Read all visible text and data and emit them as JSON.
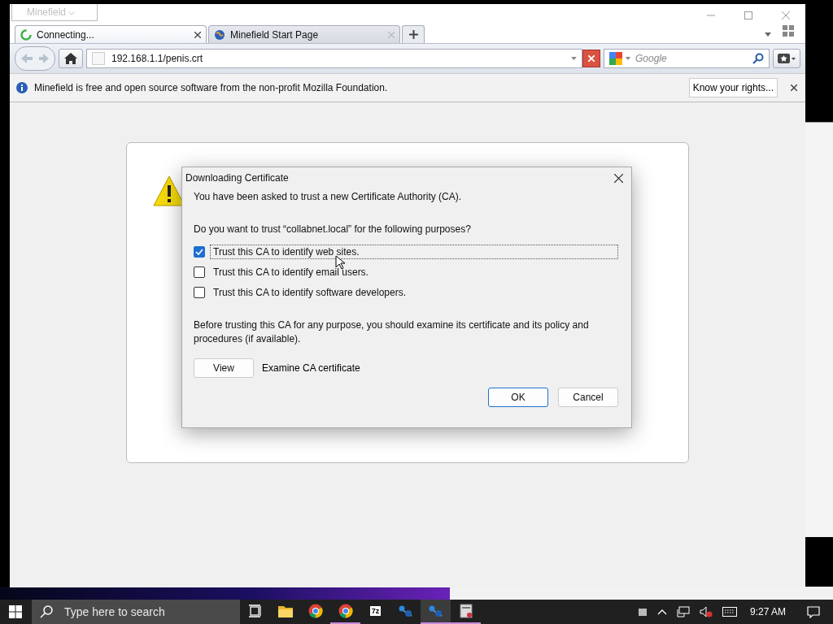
{
  "browser": {
    "app_button": "Minefield",
    "tabs": [
      {
        "label": "Connecting...",
        "selected": true,
        "kind": "loading"
      },
      {
        "label": "Minefield Start Page",
        "selected": false,
        "kind": "globe"
      }
    ],
    "address": "192.168.1.1/penis.crt",
    "search": {
      "placeholder": "Google"
    },
    "notification": {
      "text": "Minefield is free and open source software from the non-profit Mozilla Foundation.",
      "button": "Know your rights..."
    }
  },
  "dialog": {
    "title": "Downloading Certificate",
    "intro": "You have been asked to trust a new Certificate Authority (CA).",
    "question": "Do you want to trust “collabnet.local” for the following purposes?",
    "options": [
      {
        "label": "Trust this CA to identify web sites.",
        "checked": true
      },
      {
        "label": "Trust this CA to identify email users.",
        "checked": false
      },
      {
        "label": "Trust this CA to identify software developers.",
        "checked": false
      }
    ],
    "advice": "Before trusting this CA for any purpose, you should examine its certificate and its policy and procedures (if available).",
    "view_button": "View",
    "view_label": "Examine CA certificate",
    "buttons": [
      {
        "label": "OK",
        "kind": "default"
      },
      {
        "label": "Cancel",
        "kind": "normal"
      }
    ]
  },
  "taskbar": {
    "search": {
      "placeholder": "Type here to search"
    },
    "apps": [
      {
        "kind": "taskview",
        "running": false,
        "selected": false
      },
      {
        "kind": "folder",
        "running": false,
        "selected": false
      },
      {
        "kind": "chrome",
        "running": false,
        "selected": false
      },
      {
        "kind": "chrome",
        "running": true,
        "selected": false
      },
      {
        "kind": "archive",
        "label": "7z",
        "running": false,
        "selected": false
      },
      {
        "kind": "network",
        "running": false,
        "selected": false
      },
      {
        "kind": "network",
        "running": true,
        "selected": true
      },
      {
        "kind": "app",
        "running": true,
        "selected": false
      }
    ],
    "time": "9:27 AM"
  }
}
